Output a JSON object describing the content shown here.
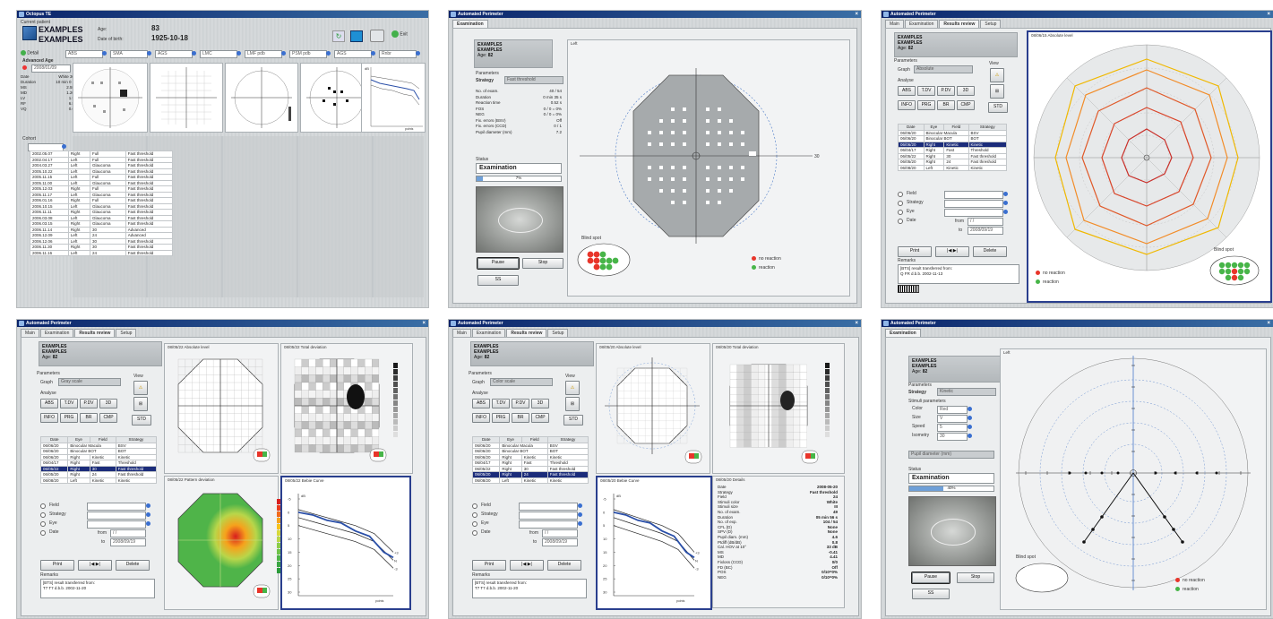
{
  "s1": {
    "title": "Octopus TE",
    "patient_header": "Current patient",
    "surname": "EXAMPLES",
    "firstname": "EXAMPLES",
    "age_label": "Age:",
    "age_value": "83",
    "dob_label": "Date of birth:",
    "dob_value": "1925-10-18",
    "exit_label": "Exit",
    "detail_label": "Detail",
    "adv_age_label": "Advanced Age",
    "date_field": "2008/01/09",
    "stats_head": "White 30",
    "stats": [
      [
        "Date",
        "White 30"
      ],
      [
        "Duration",
        "10 min 0 s"
      ],
      [
        "MS",
        "2.55"
      ],
      [
        "MD",
        "1.20"
      ],
      [
        "LV",
        "1.9"
      ],
      [
        "RF",
        "6.8"
      ],
      [
        "VQ",
        "0.6"
      ]
    ],
    "dropdowns": [
      "ABS",
      "SMA",
      "AGS",
      "LMC",
      "LMF pdb",
      "PSM pdb",
      "AGS",
      "Rnbr"
    ],
    "cohort_label": "Cohort",
    "table_rows": [
      [
        "2002.05.07",
        "Right",
        "Full",
        "Fast threshold"
      ],
      [
        "2002.04.17",
        "Left",
        "Full",
        "Fast threshold"
      ],
      [
        "2004.03.27",
        "Left",
        "Glaucoma",
        "Fast threshold"
      ],
      [
        "2005.10.22",
        "Left",
        "Glaucoma",
        "Fast threshold"
      ],
      [
        "2005.11.15",
        "Left",
        "Full",
        "Fast threshold"
      ],
      [
        "2005.11.00",
        "Left",
        "Glaucoma",
        "Fast threshold"
      ],
      [
        "2005.12.03",
        "Right",
        "Full",
        "Fast threshold"
      ],
      [
        "2005.11.17",
        "Left",
        "Glaucoma",
        "Fast threshold"
      ],
      [
        "2006.01.16",
        "Right",
        "Full",
        "Fast threshold"
      ],
      [
        "2006.10.15",
        "Left",
        "Glaucoma",
        "Fast threshold"
      ],
      [
        "2006.11.11",
        "Right",
        "Glaucoma",
        "Fast threshold"
      ],
      [
        "2006.03.08",
        "Left",
        "Glaucoma",
        "Fast threshold"
      ],
      [
        "2006.03.15",
        "Right",
        "Glaucoma",
        "Fast threshold"
      ],
      [
        "2006.11.14",
        "Right",
        "30",
        "Advanced"
      ],
      [
        "2006.12.09",
        "Left",
        "24",
        "Advanced"
      ],
      [
        "2006.12.06",
        "Left",
        "30",
        "Fast threshold"
      ],
      [
        "2006.11.30",
        "Right",
        "30",
        "Fast threshold"
      ],
      [
        "2006.11.16",
        "Left",
        "24",
        "Fast threshold"
      ]
    ],
    "chart_unit": "dB",
    "chart_x_label": "points"
  },
  "common": {
    "window_title": "Automated Perimeter",
    "tab_main": "Main",
    "tab_exam": "Examination",
    "tab_results": "Results review",
    "tab_setup": "Setup",
    "patient_surname": "EXAMPLES",
    "patient_firstname": "EXAMPLES",
    "age_label": "Age:",
    "age_value": "82",
    "params_label": "Parameters",
    "strategy_label": "Strategy",
    "status_label": "Status",
    "status_value": "Examination",
    "pause": "Pause",
    "stop": "Stop",
    "ss": "SS",
    "blind_spot": "Blind spot",
    "no_reaction": "no reaction",
    "reaction": "reaction",
    "print": "Print",
    "delete": "Delete",
    "graph_label": "Graph",
    "analyse_label": "Analyse",
    "view_label": "View",
    "std": "STD",
    "analyse_btns": [
      "ABS",
      "T.DV",
      "P.DV",
      "3D"
    ],
    "analyse_btns2": [
      "INFO",
      "PRG",
      "BR",
      "CMP"
    ],
    "filter_labels": [
      "Field",
      "Strategy",
      "Eye",
      "Date"
    ],
    "from_label": "from",
    "to_label": "to",
    "from_value": "/ /",
    "to_value": "2008/09/19",
    "remarks_label": "Remarks",
    "remarks_text1": "[BTS] result transferred from:",
    "remarks_text2": "Q FR d.b.b. 2002-11-13",
    "remarks_text3": "T7 T7 d.b.b. 2002-11-20",
    "table_head": [
      "Date",
      "Eye",
      "Field",
      "Strategy"
    ],
    "rows": [
      [
        "06/06/20",
        "Binocular Macula",
        "BSV"
      ],
      [
        "06/06/20",
        "Binocular BOT",
        "BOT"
      ],
      [
        "06/06/20",
        "Right",
        "Kinetic",
        "Kinetic"
      ],
      [
        "06/04/17",
        "Right",
        "Fast",
        "Threshold"
      ],
      [
        "06/05/22",
        "Right",
        "30",
        "Fast threshold"
      ],
      [
        "06/05/20",
        "Right",
        "24",
        "Fast threshold"
      ],
      [
        "06/08/20",
        "Left",
        "Kinetic",
        "Kinetic"
      ]
    ]
  },
  "s2": {
    "strategy_value": "Fast threshold",
    "stats": [
      [
        "No. of exam.",
        "40 / 54"
      ],
      [
        "Duration",
        "0 min 35 s"
      ],
      [
        "Reaction time",
        "0.52 s"
      ],
      [
        "FOS",
        "0 / 0 = 0%"
      ],
      [
        "NEG",
        "0 / 0 = 0%"
      ],
      [
        "Fix. errors (BSV)",
        "Off"
      ],
      [
        "Fix. errors (CCD)",
        "0 / 1"
      ],
      [
        "Pupil diameter (mm)",
        "7.2"
      ]
    ],
    "progress": 7,
    "progress_text": "7%",
    "field_label": "Left",
    "axis_right": "30"
  },
  "s3": {
    "graph_value": "Absolute",
    "panel_title": "08/06/15   Absolute level",
    "sel_row": 2,
    "blind_spot": "Blind spot"
  },
  "s4": {
    "graph_value": "Gray scale",
    "p1": "08/05/22   Absolute level",
    "p2": "08/05/22   Total deviation",
    "p3": "08/05/22   Pattern deviation",
    "p4": "08/05/22   Bebie Curve",
    "curve_unit": "dB",
    "curve_x": "points",
    "yticks": [
      "-5",
      "0",
      "5",
      "10",
      "15",
      "20",
      "25",
      "30"
    ],
    "labels": [
      "+3",
      "N",
      "-3"
    ],
    "sel_row": 4
  },
  "s5": {
    "graph_value": "Color scale",
    "p1": "08/05/20   Absolute level",
    "p2": "08/05/20   Total deviation",
    "p3": "08/05/20   Bebie Curve",
    "p4": "08/05/20   Details",
    "details": [
      [
        "Date",
        "2008-05-20"
      ],
      [
        "Strategy",
        "Fast threshold"
      ],
      [
        "Field",
        "24"
      ],
      [
        "Stimuli color",
        "White"
      ],
      [
        "Stimuli size",
        "III"
      ],
      [
        "No. of exam.",
        "49"
      ],
      [
        "Duration",
        "05 min 56 s"
      ],
      [
        "No. of exp.",
        "104 / 54"
      ],
      [
        "CFL (D)",
        "None"
      ],
      [
        "SPV (D)",
        "None"
      ],
      [
        "Pupil diam. (mm)",
        "4.6"
      ],
      [
        "Ptdiff (dB/dB)",
        "0.8"
      ],
      [
        "Cal. HOV at 10°",
        "33 dB"
      ],
      [
        "MS",
        "-0.41"
      ],
      [
        "MD",
        "4.41"
      ],
      [
        "Fixloss (CCD)",
        "0/0"
      ],
      [
        "FD (BC)",
        "Off"
      ],
      [
        "POS",
        "0/10=0%"
      ],
      [
        "NEG",
        "0/10=0%"
      ]
    ],
    "sel_row": 5
  },
  "s6": {
    "strategy_value": "Kinetic",
    "stim_label": "Stimuli parameters",
    "stim": [
      [
        "Color",
        "Red"
      ],
      [
        "Size",
        "V"
      ],
      [
        "Speed",
        "5"
      ],
      [
        "Isometry",
        "30"
      ]
    ],
    "pupil_label": "Pupil diameter (mm)",
    "progress": 40,
    "progress_text": "40%",
    "field_label": "Left"
  }
}
